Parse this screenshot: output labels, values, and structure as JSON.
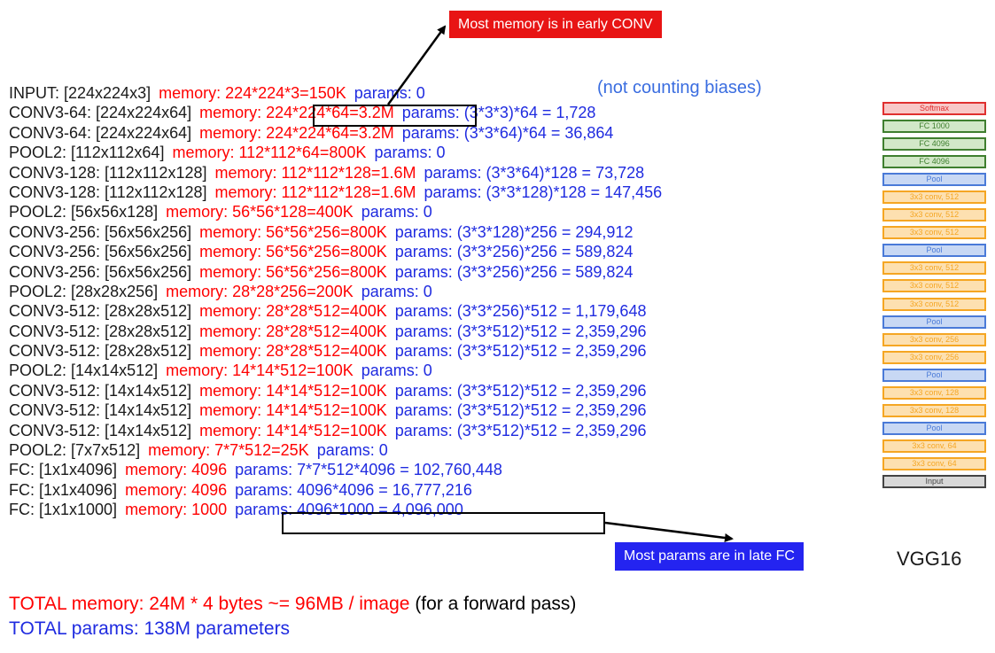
{
  "note": "(not counting biases)",
  "callouts": {
    "conv": "Most memory is in early CONV",
    "fc": "Most params are in late FC"
  },
  "colors": {
    "memory": "#ff0000",
    "params": "#1f2be0",
    "callout_conv": "#e81414",
    "callout_fc": "#2424f0"
  },
  "rows": [
    {
      "layer": "INPUT: [224x224x3]",
      "memory": "memory:  224*224*3=150K",
      "params": "params: 0"
    },
    {
      "layer": "CONV3-64: [224x224x64]",
      "memory": "memory:  224*224*64=3.2M",
      "params": "params: (3*3*3)*64 = 1,728"
    },
    {
      "layer": "CONV3-64: [224x224x64]",
      "memory": "memory:  224*224*64=3.2M",
      "params": "params: (3*3*64)*64 = 36,864"
    },
    {
      "layer": "POOL2: [112x112x64]",
      "memory": "memory:  112*112*64=800K",
      "params": "params: 0"
    },
    {
      "layer": "CONV3-128: [112x112x128]",
      "memory": "memory:  112*112*128=1.6M",
      "params": "params: (3*3*64)*128 = 73,728"
    },
    {
      "layer": "CONV3-128: [112x112x128]",
      "memory": "memory:  112*112*128=1.6M",
      "params": "params: (3*3*128)*128 = 147,456"
    },
    {
      "layer": "POOL2: [56x56x128]",
      "memory": "memory:  56*56*128=400K",
      "params": "params: 0"
    },
    {
      "layer": "CONV3-256: [56x56x256]",
      "memory": "memory:  56*56*256=800K",
      "params": "params: (3*3*128)*256 = 294,912"
    },
    {
      "layer": "CONV3-256: [56x56x256]",
      "memory": "memory:  56*56*256=800K",
      "params": "params: (3*3*256)*256 = 589,824"
    },
    {
      "layer": "CONV3-256: [56x56x256]",
      "memory": "memory:  56*56*256=800K",
      "params": "params: (3*3*256)*256 = 589,824"
    },
    {
      "layer": "POOL2: [28x28x256]",
      "memory": "memory:  28*28*256=200K",
      "params": "params: 0"
    },
    {
      "layer": "CONV3-512: [28x28x512]",
      "memory": "memory:  28*28*512=400K",
      "params": "params: (3*3*256)*512 = 1,179,648"
    },
    {
      "layer": "CONV3-512: [28x28x512]",
      "memory": "memory:  28*28*512=400K",
      "params": "params: (3*3*512)*512 = 2,359,296"
    },
    {
      "layer": "CONV3-512: [28x28x512]",
      "memory": "memory:  28*28*512=400K",
      "params": "params: (3*3*512)*512 = 2,359,296"
    },
    {
      "layer": "POOL2: [14x14x512]",
      "memory": "memory:  14*14*512=100K",
      "params": "params: 0"
    },
    {
      "layer": "CONV3-512: [14x14x512]",
      "memory": "memory:  14*14*512=100K",
      "params": "params: (3*3*512)*512 = 2,359,296"
    },
    {
      "layer": "CONV3-512: [14x14x512]",
      "memory": "memory:  14*14*512=100K",
      "params": "params: (3*3*512)*512 = 2,359,296"
    },
    {
      "layer": "CONV3-512: [14x14x512]",
      "memory": "memory:  14*14*512=100K",
      "params": "params: (3*3*512)*512 = 2,359,296"
    },
    {
      "layer": "POOL2: [7x7x512]",
      "memory": "memory:  7*7*512=25K",
      "params": "params: 0"
    },
    {
      "layer": "FC: [1x1x4096]",
      "memory": "memory:  4096",
      "params": "params: 7*7*512*4096 = 102,760,448"
    },
    {
      "layer": "FC: [1x1x4096]",
      "memory": "memory:  4096",
      "params": "params: 4096*4096 = 16,777,216"
    },
    {
      "layer": "FC: [1x1x1000]",
      "memory": "memory:  1000",
      "params": "params: 4096*1000 = 4,096,000"
    }
  ],
  "totals": {
    "memory": "TOTAL memory: 24M * 4 bytes ~= 96MB / image",
    "memory_suffix": "(for a forward pass)",
    "params": "TOTAL params: 138M parameters"
  },
  "stack": {
    "title": "VGG16",
    "blocks": [
      {
        "label": "Softmax",
        "kind": "softmax"
      },
      {
        "label": "FC 1000",
        "kind": "fc"
      },
      {
        "label": "FC 4096",
        "kind": "fc"
      },
      {
        "label": "FC 4096",
        "kind": "fc"
      },
      {
        "label": "Pool",
        "kind": "pool"
      },
      {
        "label": "3x3 conv, 512",
        "kind": "conv"
      },
      {
        "label": "3x3 conv, 512",
        "kind": "conv"
      },
      {
        "label": "3x3 conv, 512",
        "kind": "conv"
      },
      {
        "label": "Pool",
        "kind": "pool"
      },
      {
        "label": "3x3 conv, 512",
        "kind": "conv"
      },
      {
        "label": "3x3 conv, 512",
        "kind": "conv"
      },
      {
        "label": "3x3 conv, 512",
        "kind": "conv"
      },
      {
        "label": "Pool",
        "kind": "pool"
      },
      {
        "label": "3x3 conv, 256",
        "kind": "conv"
      },
      {
        "label": "3x3 conv, 256",
        "kind": "conv"
      },
      {
        "label": "Pool",
        "kind": "pool"
      },
      {
        "label": "3x3 conv, 128",
        "kind": "conv"
      },
      {
        "label": "3x3 conv, 128",
        "kind": "conv"
      },
      {
        "label": "Pool",
        "kind": "pool"
      },
      {
        "label": "3x3 conv, 64",
        "kind": "conv"
      },
      {
        "label": "3x3 conv, 64",
        "kind": "conv"
      },
      {
        "label": "Input",
        "kind": "input"
      }
    ]
  }
}
